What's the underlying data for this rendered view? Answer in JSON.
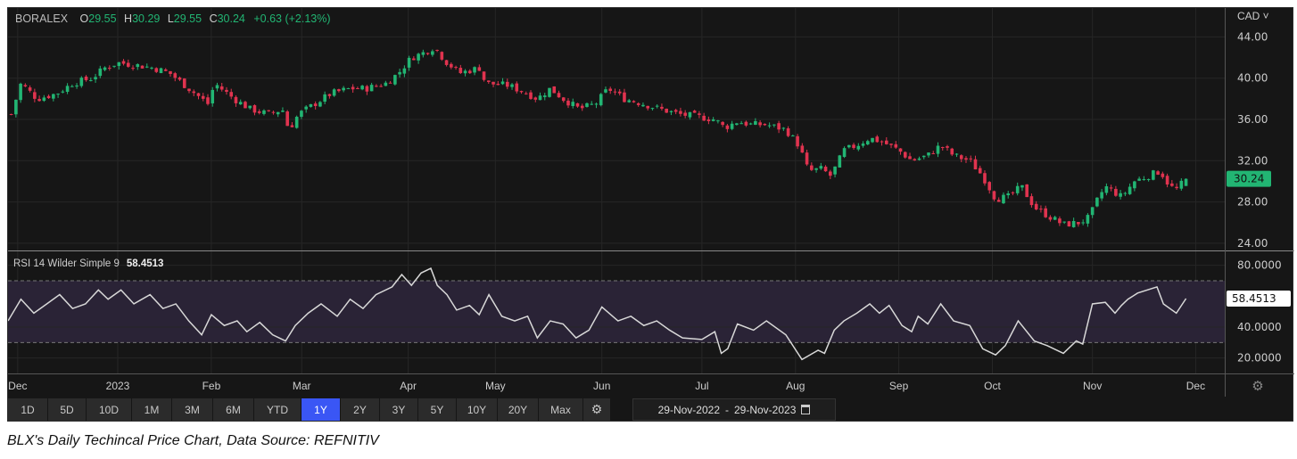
{
  "header": {
    "symbol": "BORALEX",
    "open_label": "O",
    "open": "29.55",
    "high_label": "H",
    "high": "30.29",
    "low_label": "L",
    "low": "29.55",
    "close_label": "C",
    "close": "30.24",
    "change": "+0.63 (+2.13%)"
  },
  "currency_selector": "CAD ˅",
  "last_price_badge": "30.24",
  "rsi": {
    "label": "RSI 14 Wilder Simple 9",
    "value": "58.4513"
  },
  "toolbar": {
    "buttons": [
      "1D",
      "5D",
      "10D",
      "1M",
      "3M",
      "6M",
      "YTD",
      "1Y",
      "2Y",
      "3Y",
      "5Y",
      "10Y",
      "20Y",
      "Max"
    ],
    "active": "1Y",
    "date_from": "29-Nov-2022",
    "date_sep": "-",
    "date_to": "29-Nov-2023"
  },
  "caption": "BLX's Daily Techincal Price Chart, Data Source: REFNITIV",
  "colors": {
    "up": "#22b573",
    "down": "#e0334f",
    "background": "#161616",
    "rsi_line": "#d8d8d8",
    "rsi_band": "#2a2336",
    "active": "#3a56f5"
  },
  "chart_data": [
    {
      "type": "candlestick",
      "title": "BORALEX",
      "x_unit": "days since 29-Nov-2022",
      "xlim": [
        -1,
        376
      ],
      "ylim": [
        23.3,
        46.8
      ],
      "yticks": [
        44,
        40,
        36,
        32,
        28,
        24
      ],
      "ytick_labels": [
        "44.00",
        "40.00",
        "36.00",
        "32.00",
        "28.00",
        "24.00"
      ],
      "xticks": [
        {
          "day": 2,
          "label": "Dec"
        },
        {
          "day": 33,
          "label": "2023"
        },
        {
          "day": 62,
          "label": "Feb"
        },
        {
          "day": 90,
          "label": "Mar"
        },
        {
          "day": 123,
          "label": "Apr"
        },
        {
          "day": 150,
          "label": "May"
        },
        {
          "day": 183,
          "label": "Jun"
        },
        {
          "day": 214,
          "label": "Jul"
        },
        {
          "day": 243,
          "label": "Aug"
        },
        {
          "day": 275,
          "label": "Sep"
        },
        {
          "day": 304,
          "label": "Oct"
        },
        {
          "day": 335,
          "label": "Nov"
        },
        {
          "day": 367,
          "label": "Dec"
        }
      ],
      "close_points": [
        [
          0,
          36.5
        ],
        [
          3,
          39.5
        ],
        [
          8,
          38
        ],
        [
          14,
          38.5
        ],
        [
          19,
          39.5
        ],
        [
          25,
          40
        ],
        [
          29,
          41
        ],
        [
          33,
          41.5
        ],
        [
          38,
          41.3
        ],
        [
          44,
          41
        ],
        [
          49,
          40.5
        ],
        [
          55,
          39
        ],
        [
          61,
          37.5
        ],
        [
          63,
          39.5
        ],
        [
          69,
          38
        ],
        [
          74,
          37
        ],
        [
          80,
          36.5
        ],
        [
          84,
          37
        ],
        [
          86,
          35
        ],
        [
          89,
          36.5
        ],
        [
          94,
          37.5
        ],
        [
          99,
          38.5
        ],
        [
          105,
          39
        ],
        [
          110,
          39
        ],
        [
          116,
          39.5
        ],
        [
          120,
          40.5
        ],
        [
          124,
          42
        ],
        [
          128,
          42.5
        ],
        [
          131,
          43
        ],
        [
          135,
          41.5
        ],
        [
          139,
          40.5
        ],
        [
          145,
          41
        ],
        [
          147,
          39.5
        ],
        [
          154,
          39.3
        ],
        [
          160,
          38.5
        ],
        [
          163,
          38
        ],
        [
          167,
          39
        ],
        [
          171,
          38
        ],
        [
          176,
          37
        ],
        [
          181,
          37.5
        ],
        [
          185,
          39
        ],
        [
          190,
          38
        ],
        [
          196,
          37.5
        ],
        [
          201,
          37
        ],
        [
          207,
          36.5
        ],
        [
          212,
          36.3
        ],
        [
          218,
          36
        ],
        [
          221,
          35.2
        ],
        [
          225,
          35.8
        ],
        [
          229,
          35.5
        ],
        [
          234,
          35.5
        ],
        [
          240,
          35
        ],
        [
          244,
          33.5
        ],
        [
          247,
          31
        ],
        [
          251,
          31.2
        ],
        [
          254,
          30.5
        ],
        [
          258,
          33
        ],
        [
          262,
          33.5
        ],
        [
          266,
          34.2
        ],
        [
          270,
          33.8
        ],
        [
          275,
          33
        ],
        [
          279,
          32
        ],
        [
          284,
          32.5
        ],
        [
          288,
          33.5
        ],
        [
          292,
          32.5
        ],
        [
          297,
          32
        ],
        [
          301,
          30.5
        ],
        [
          305,
          28.3
        ],
        [
          309,
          28.5
        ],
        [
          313,
          29.5
        ],
        [
          317,
          27.5
        ],
        [
          321,
          26.7
        ],
        [
          326,
          25.8
        ],
        [
          331,
          26
        ],
        [
          334,
          26.5
        ],
        [
          337,
          28.5
        ],
        [
          339,
          29.5
        ],
        [
          344,
          28.5
        ],
        [
          348,
          30
        ],
        [
          352,
          30.5
        ],
        [
          356,
          31
        ],
        [
          359,
          29.5
        ],
        [
          361,
          29.2
        ],
        [
          364,
          30.24
        ]
      ],
      "last_candle": {
        "open": 29.55,
        "high": 30.29,
        "low": 29.55,
        "close": 30.24
      }
    },
    {
      "type": "line",
      "title": "RSI 14 Wilder Simple 9",
      "ylim": [
        10,
        89
      ],
      "band": [
        30,
        70
      ],
      "yticks": [
        80,
        40,
        20
      ],
      "ytick_labels": [
        "80.0000",
        "40.0000",
        "20.0000"
      ],
      "points": [
        [
          -1,
          44
        ],
        [
          3,
          58
        ],
        [
          7,
          49
        ],
        [
          11,
          55
        ],
        [
          15,
          61
        ],
        [
          19,
          52
        ],
        [
          23,
          55
        ],
        [
          27,
          64
        ],
        [
          30,
          58
        ],
        [
          34,
          64
        ],
        [
          38,
          55
        ],
        [
          43,
          61
        ],
        [
          47,
          52
        ],
        [
          51,
          55
        ],
        [
          55,
          44
        ],
        [
          59,
          35
        ],
        [
          62,
          48
        ],
        [
          66,
          41
        ],
        [
          70,
          44
        ],
        [
          73,
          37
        ],
        [
          77,
          43
        ],
        [
          81,
          35
        ],
        [
          85,
          31
        ],
        [
          88,
          41
        ],
        [
          92,
          49
        ],
        [
          96,
          55
        ],
        [
          101,
          47
        ],
        [
          105,
          58
        ],
        [
          109,
          52
        ],
        [
          113,
          61
        ],
        [
          118,
          66
        ],
        [
          121,
          74
        ],
        [
          124,
          67
        ],
        [
          127,
          75
        ],
        [
          130,
          78
        ],
        [
          132,
          67
        ],
        [
          135,
          61
        ],
        [
          138,
          51
        ],
        [
          142,
          54
        ],
        [
          145,
          48
        ],
        [
          148,
          61
        ],
        [
          152,
          47
        ],
        [
          156,
          44
        ],
        [
          160,
          47
        ],
        [
          163,
          33
        ],
        [
          167,
          44
        ],
        [
          171,
          42
        ],
        [
          175,
          33
        ],
        [
          179,
          38
        ],
        [
          183,
          53
        ],
        [
          188,
          44
        ],
        [
          192,
          47
        ],
        [
          196,
          41
        ],
        [
          200,
          44
        ],
        [
          204,
          38
        ],
        [
          208,
          33
        ],
        [
          214,
          32
        ],
        [
          218,
          37
        ],
        [
          220,
          23
        ],
        [
          222,
          26
        ],
        [
          225,
          42
        ],
        [
          230,
          38
        ],
        [
          234,
          44
        ],
        [
          240,
          35
        ],
        [
          245,
          19
        ],
        [
          250,
          25
        ],
        [
          252,
          23
        ],
        [
          255,
          38
        ],
        [
          258,
          44
        ],
        [
          262,
          49
        ],
        [
          266,
          55
        ],
        [
          269,
          49
        ],
        [
          272,
          54
        ],
        [
          276,
          41
        ],
        [
          279,
          37
        ],
        [
          281,
          47
        ],
        [
          284,
          42
        ],
        [
          288,
          55
        ],
        [
          292,
          44
        ],
        [
          297,
          41
        ],
        [
          301,
          26
        ],
        [
          305,
          22
        ],
        [
          308,
          28
        ],
        [
          312,
          44
        ],
        [
          317,
          31
        ],
        [
          321,
          28
        ],
        [
          326,
          23
        ],
        [
          330,
          31
        ],
        [
          332,
          29
        ],
        [
          335,
          55
        ],
        [
          339,
          56
        ],
        [
          342,
          49
        ],
        [
          344,
          54
        ],
        [
          346,
          58
        ],
        [
          349,
          62
        ],
        [
          355,
          66
        ],
        [
          357,
          55
        ],
        [
          361,
          49
        ],
        [
          364,
          58.45
        ]
      ]
    }
  ]
}
